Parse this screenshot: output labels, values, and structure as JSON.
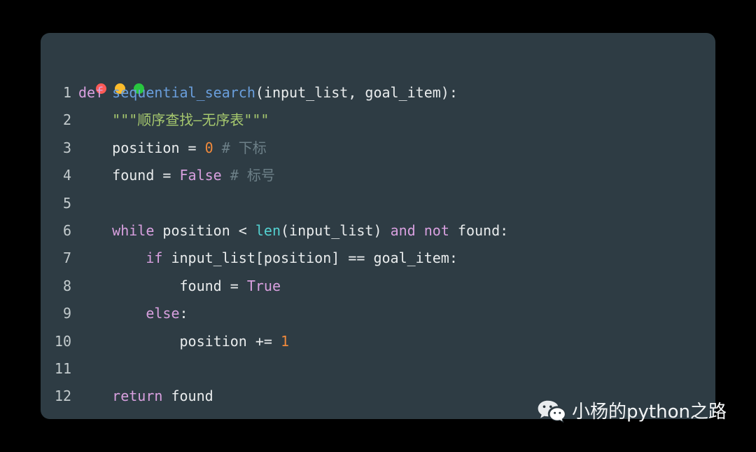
{
  "window": {
    "controls": [
      {
        "name": "close",
        "color": "#fc5b57"
      },
      {
        "name": "minimize",
        "color": "#fcbc2c"
      },
      {
        "name": "maximize",
        "color": "#28c63f"
      }
    ],
    "background_color": "#000000",
    "card_color": "#2e3c44"
  },
  "editor": {
    "language": "python",
    "theme_colors": {
      "keyword": "#d8a0df",
      "function": "#6a9fdd",
      "builtin": "#54d1d1",
      "number": "#f0893b",
      "string": "#a6c86e",
      "comment": "#6d8088",
      "text": "#e9eced",
      "linenumber": "#c3cbcd"
    },
    "lines": [
      {
        "number": "1",
        "tokens": [
          {
            "t": "def",
            "c": "kw"
          },
          {
            "t": " ",
            "c": "plain"
          },
          {
            "t": "sequential_search",
            "c": "fn"
          },
          {
            "t": "(input_list, goal_item):",
            "c": "plain"
          }
        ]
      },
      {
        "number": "2",
        "tokens": [
          {
            "t": "    ",
            "c": "plain"
          },
          {
            "t": "\"\"\"顺序查找—无序表\"\"\"",
            "c": "str"
          }
        ]
      },
      {
        "number": "3",
        "tokens": [
          {
            "t": "    position = ",
            "c": "plain"
          },
          {
            "t": "0",
            "c": "num"
          },
          {
            "t": " ",
            "c": "plain"
          },
          {
            "t": "# 下标",
            "c": "com"
          }
        ]
      },
      {
        "number": "4",
        "tokens": [
          {
            "t": "    found = ",
            "c": "plain"
          },
          {
            "t": "False",
            "c": "kw"
          },
          {
            "t": " ",
            "c": "plain"
          },
          {
            "t": "# 标号",
            "c": "com"
          }
        ]
      },
      {
        "number": "5",
        "tokens": [
          {
            "t": "",
            "c": "plain"
          }
        ]
      },
      {
        "number": "6",
        "tokens": [
          {
            "t": "    ",
            "c": "plain"
          },
          {
            "t": "while",
            "c": "kw"
          },
          {
            "t": " position < ",
            "c": "plain"
          },
          {
            "t": "len",
            "c": "builtin"
          },
          {
            "t": "(input_list) ",
            "c": "plain"
          },
          {
            "t": "and",
            "c": "kw"
          },
          {
            "t": " ",
            "c": "plain"
          },
          {
            "t": "not",
            "c": "kw"
          },
          {
            "t": " found:",
            "c": "plain"
          }
        ]
      },
      {
        "number": "7",
        "tokens": [
          {
            "t": "        ",
            "c": "plain"
          },
          {
            "t": "if",
            "c": "kw"
          },
          {
            "t": " input_list[position] == goal_item:",
            "c": "plain"
          }
        ]
      },
      {
        "number": "8",
        "tokens": [
          {
            "t": "            found = ",
            "c": "plain"
          },
          {
            "t": "True",
            "c": "kw"
          }
        ]
      },
      {
        "number": "9",
        "tokens": [
          {
            "t": "        ",
            "c": "plain"
          },
          {
            "t": "else",
            "c": "kw"
          },
          {
            "t": ":",
            "c": "plain"
          }
        ]
      },
      {
        "number": "10",
        "tokens": [
          {
            "t": "            position += ",
            "c": "plain"
          },
          {
            "t": "1",
            "c": "num"
          }
        ]
      },
      {
        "number": "11",
        "tokens": [
          {
            "t": "",
            "c": "plain"
          }
        ]
      },
      {
        "number": "12",
        "tokens": [
          {
            "t": "    ",
            "c": "plain"
          },
          {
            "t": "return",
            "c": "kw"
          },
          {
            "t": " found",
            "c": "plain"
          }
        ]
      }
    ]
  },
  "watermark": {
    "icon": "wechat-icon",
    "text": "小杨的python之路",
    "text_color": "#f2f4f5"
  }
}
